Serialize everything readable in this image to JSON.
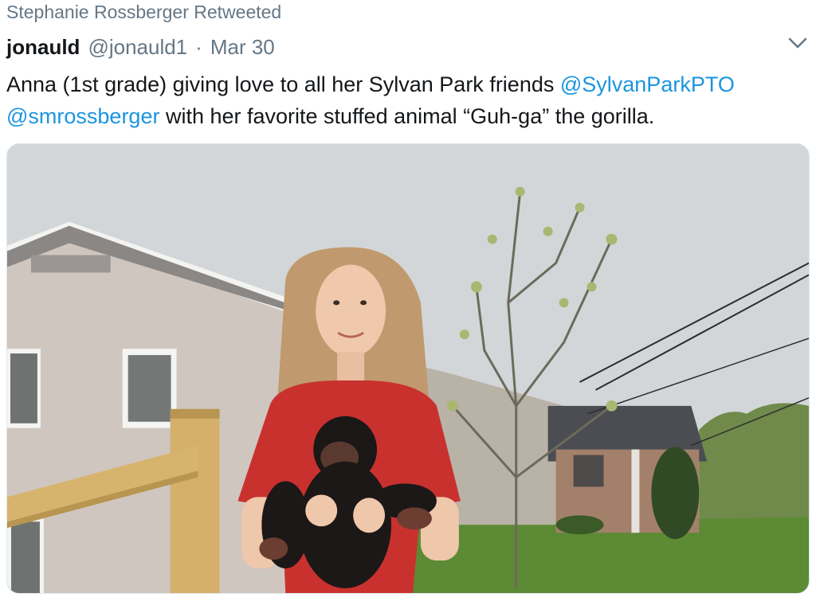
{
  "retweet": {
    "text": "Stephanie Rossberger Retweeted"
  },
  "author": {
    "name": "jonauld",
    "handle": "@jonauld1",
    "separator": "·",
    "date": "Mar 30"
  },
  "tweet": {
    "part1": "Anna (1st grade) giving love to all her Sylvan Park friends ",
    "mention1": "@SylvanParkPTO",
    "mention2": "@smrossberger",
    "part2": " with her favorite stuffed animal “Guh-ga” the gorilla."
  },
  "media": {
    "alt": "photo"
  },
  "icons": {
    "menu": "chevron-down-icon"
  },
  "colors": {
    "link": "#1b95e0",
    "secondary": "#657786",
    "text": "#14171a"
  }
}
